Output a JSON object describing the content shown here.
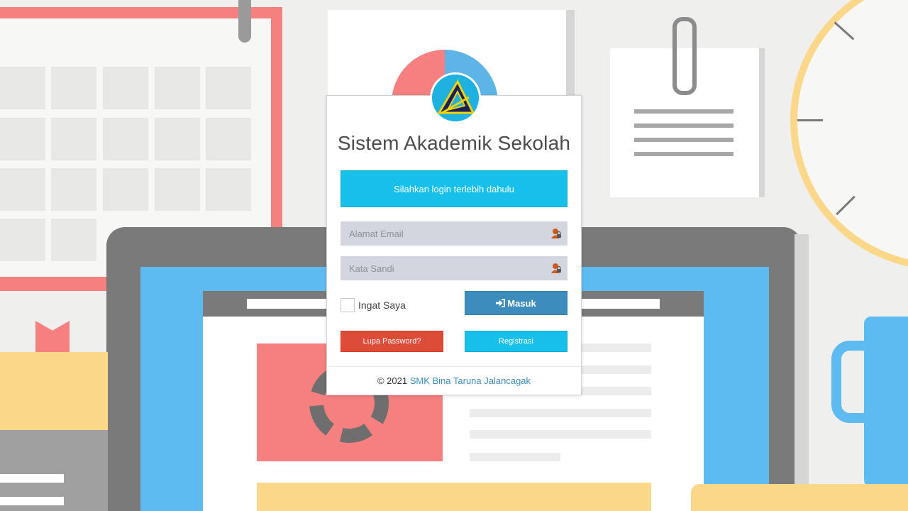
{
  "app": {
    "title": "Sistem Akademik Sekolah"
  },
  "alert": {
    "message": "Silahkan login terlebih dahulu"
  },
  "form": {
    "email": {
      "placeholder": "Alamat Email",
      "value": "",
      "icon": "user-lock-icon"
    },
    "password": {
      "placeholder": "Kata Sandi",
      "value": "",
      "icon": "lock-icon"
    },
    "remember_label": "Ingat Saya",
    "remember_checked": false,
    "submit_label": "Masuk",
    "submit_icon": "sign-in-icon"
  },
  "actions": {
    "forgot_label": "Lupa Password?",
    "register_label": "Registrasi"
  },
  "footer": {
    "copyright": "© 2021",
    "org_link": "SMK Bina Taruna Jalancagak"
  },
  "colors": {
    "primary": "#3c8dbc",
    "info": "#16c0ea",
    "danger": "#dd4b39",
    "input_bg": "#d2d6de"
  }
}
